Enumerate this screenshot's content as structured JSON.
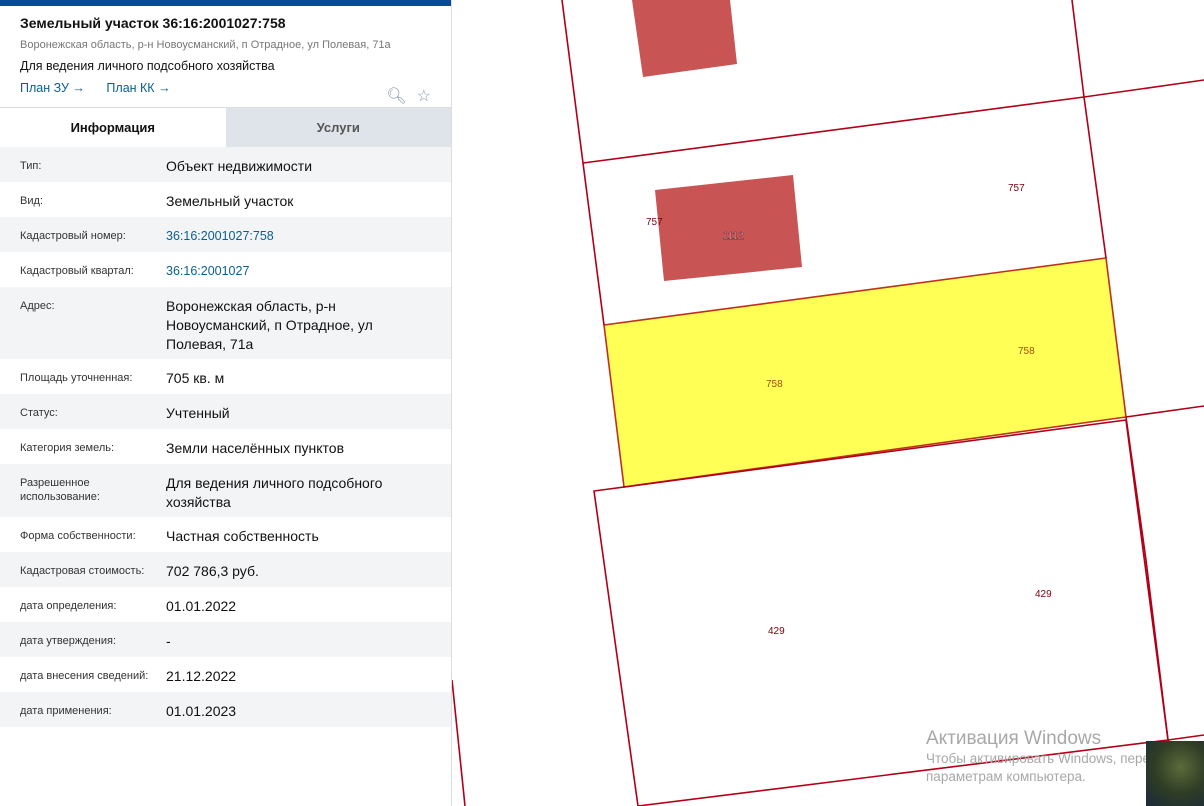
{
  "header": {
    "title": "Земельный участок 36:16:2001027:758",
    "address": "Воронежская область, р-н Новоусманский, п Отрадное, ул Полевая, 71а",
    "purpose": "Для ведения личного подсобного хозяйства",
    "link_plan_zu": "План ЗУ →",
    "link_plan_kk": "План КК →"
  },
  "tabs": [
    {
      "label": "Информация"
    },
    {
      "label": "Услуги"
    }
  ],
  "rows": [
    {
      "label": "Тип:",
      "value": "Объект недвижимости"
    },
    {
      "label": "Вид:",
      "value": "Земельный участок"
    },
    {
      "label": "Кадастровый номер:",
      "value": "36:16:2001027:758",
      "link": true
    },
    {
      "label": "Кадастровый квартал:",
      "value": "36:16:2001027",
      "link": true
    },
    {
      "label": "Адрес:",
      "value": "Воронежская область, р-н Новоусманский, п Отрадное, ул Полевая, 71а"
    },
    {
      "label": "Площадь уточненная:",
      "value": "705 кв. м"
    },
    {
      "label": "Статус:",
      "value": "Учтенный"
    },
    {
      "label": "Категория земель:",
      "value": "Земли населённых пунктов"
    },
    {
      "label": "Разрешенное использование:",
      "value": "Для ведения личного подсобного хозяйства"
    },
    {
      "label": "Форма собственности:",
      "value": "Частная собственность"
    },
    {
      "label": "Кадастровая стоимость:",
      "value": "702 786,3 руб."
    },
    {
      "label": "дата определения:",
      "value": "01.01.2022"
    },
    {
      "label": "дата утверждения:",
      "value": "-"
    },
    {
      "label": "дата внесения сведений:",
      "value": "21.12.2022"
    },
    {
      "label": "дата применения:",
      "value": "01.01.2023"
    }
  ],
  "map": {
    "labels": {
      "b1112": "1112",
      "p757a": "757",
      "p757b": "757",
      "p758a": "758",
      "p758b": "758",
      "p429a": "429",
      "p429b": "429"
    }
  },
  "watermark": {
    "title": "Активация Windows",
    "line1": "Чтобы активировать Windows, перейдите к",
    "line2": "параметрам компьютера."
  }
}
